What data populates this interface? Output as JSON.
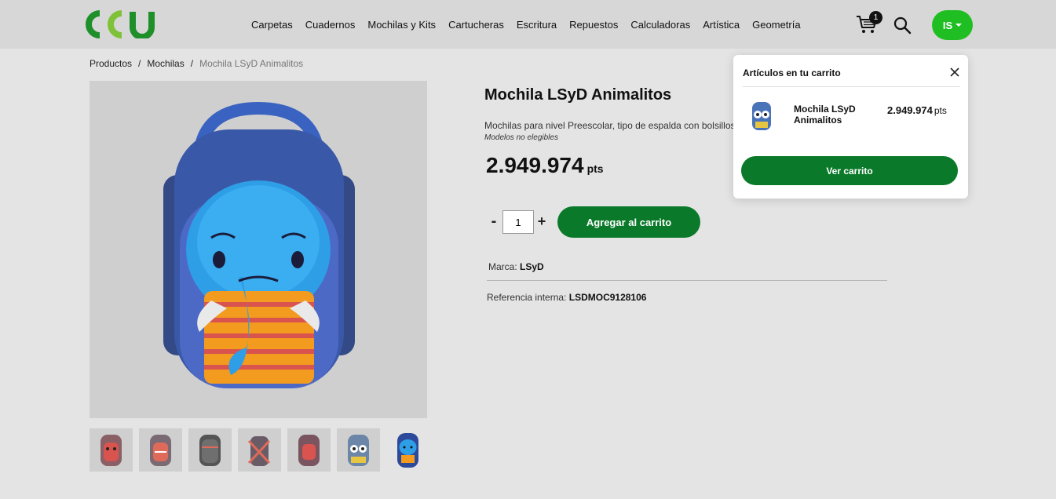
{
  "header": {
    "logo_text": "CCU",
    "nav": [
      "Carpetas",
      "Cuadernos",
      "Mochilas y Kits",
      "Cartucheras",
      "Escritura",
      "Repuestos",
      "Calculadoras",
      "Artística",
      "Geometría"
    ],
    "cart_count": "1",
    "user_initials": "IS",
    "brand_color": "#1fbf23"
  },
  "breadcrumb": {
    "items": [
      "Productos",
      "Mochilas",
      "Mochila LSyD Animalitos"
    ],
    "separator": "/"
  },
  "product": {
    "title": "Mochila LSyD Animalitos",
    "description": "Mochilas para nivel Preescolar, tipo de espalda con bolsillos",
    "models_note": "Modelos no elegibles",
    "price": "2.949.974",
    "price_unit": "pts",
    "quantity": "1",
    "qty_minus": "-",
    "qty_plus": "+",
    "add_to_cart_label": "Agregar al carrito",
    "brand_label": "Marca:",
    "brand_value": "LSyD",
    "ref_label": "Referencia interna:",
    "ref_value": "LSDMOC9128106",
    "accent_color": "#0a7a2a"
  },
  "cart_popup": {
    "title": "Artículos en tu carrito",
    "item_name": "Mochila LSyD Animalitos",
    "item_price": "2.949.974",
    "item_price_unit": "pts",
    "view_cart_label": "Ver carrito"
  },
  "icons": {
    "cart": "cart-icon",
    "search": "search-icon",
    "close": "close-icon",
    "caret": "chevron-down-icon"
  }
}
